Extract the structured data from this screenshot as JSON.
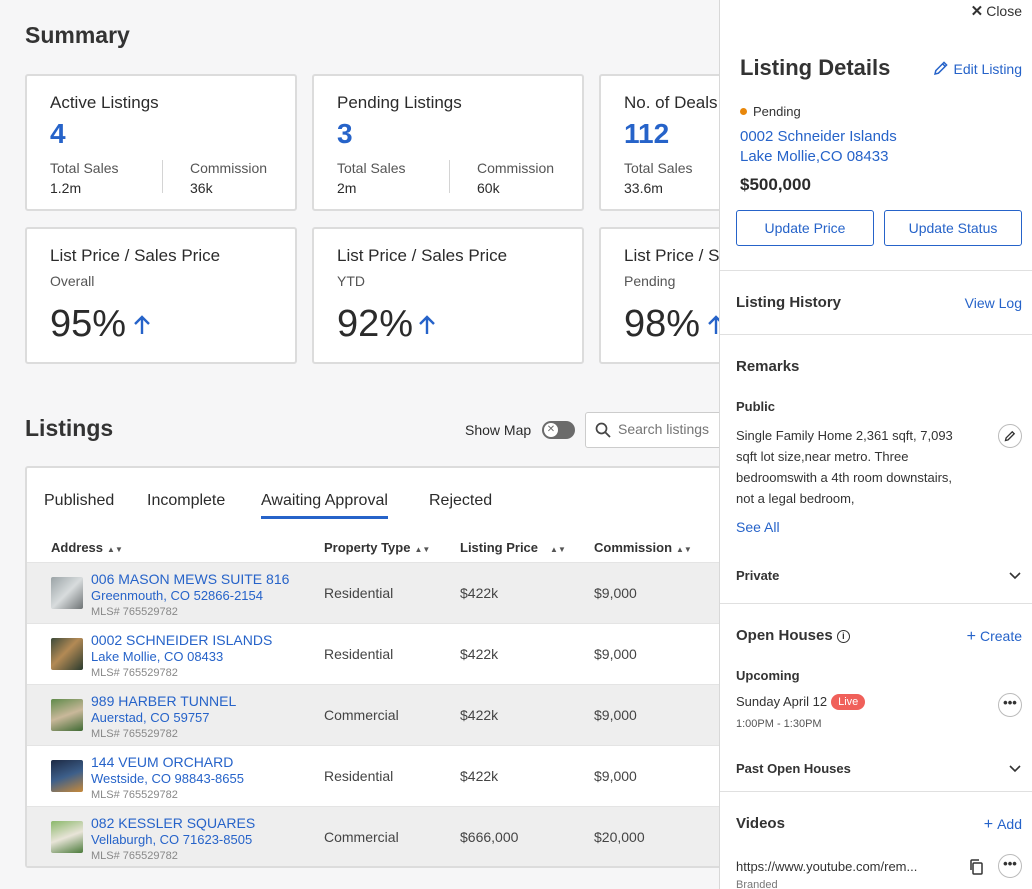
{
  "summary": {
    "title": "Summary",
    "cards": [
      {
        "title": "Active Listings",
        "count": "4",
        "sales_label": "Total Sales",
        "sales_value": "1.2m",
        "commission_label": "Commission",
        "commission_value": "36k"
      },
      {
        "title": "Pending Listings",
        "count": "3",
        "sales_label": "Total Sales",
        "sales_value": "2m",
        "commission_label": "Commission",
        "commission_value": "60k"
      },
      {
        "title": "No. of Deals",
        "count": "112",
        "sales_label": "Total Sales",
        "sales_value": "33.6m"
      }
    ],
    "ratio_cards": [
      {
        "title": "List Price / Sales Price",
        "subtitle": "Overall",
        "value": "95%"
      },
      {
        "title": "List Price / Sales Price",
        "subtitle": "YTD",
        "value": "92%"
      },
      {
        "title": "List Price / Sales Price",
        "subtitle": "Pending",
        "value": "98%"
      }
    ]
  },
  "listings": {
    "title": "Listings",
    "show_map_label": "Show Map",
    "search_placeholder": "Search listings",
    "tabs": [
      "Published",
      "Incomplete",
      "Awaiting Approval",
      "Rejected"
    ],
    "active_tab": "Awaiting Approval",
    "columns": [
      "Address",
      "Property Type",
      "Listing Price",
      "Commission"
    ],
    "rows": [
      {
        "address1": "006 MASON MEWS SUITE 816",
        "address2": "Greenmouth, CO 52866-2154",
        "mls": "MLS# 765529782",
        "type": "Residential",
        "price": "$422k",
        "commission": "$9,000"
      },
      {
        "address1": "0002 SCHNEIDER ISLANDS",
        "address2": "Lake Mollie, CO 08433",
        "mls": "MLS# 765529782",
        "type": "Residential",
        "price": "$422k",
        "commission": "$9,000"
      },
      {
        "address1": "989 HARBER TUNNEL",
        "address2": "Auerstad, CO 59757",
        "mls": "MLS# 765529782",
        "type": "Commercial",
        "price": "$422k",
        "commission": "$9,000"
      },
      {
        "address1": "144 VEUM ORCHARD",
        "address2": "Westside, CO 98843-8655",
        "mls": "MLS# 765529782",
        "type": "Residential",
        "price": "$422k",
        "commission": "$9,000"
      },
      {
        "address1": "082 KESSLER SQUARES",
        "address2": "Vellaburgh, CO 71623-8505",
        "mls": "MLS# 765529782",
        "type": "Commercial",
        "price": "$666,000",
        "commission": "$20,000"
      }
    ]
  },
  "panel": {
    "close_label": "Close",
    "title": "Listing Details",
    "edit_label": "Edit Listing",
    "status": "Pending",
    "address_line1": "0002 Schneider Islands",
    "address_line2": "Lake Mollie,CO 08433",
    "price": "$500,000",
    "update_price_label": "Update Price",
    "update_status_label": "Update Status",
    "history_title": "Listing History",
    "view_log_label": "View Log",
    "remarks_title": "Remarks",
    "public_label": "Public",
    "public_text": "Single Family Home 2,361 sqft, 7,093 sqft lot size,near metro. Three bedroomswith a 4th room downstairs, not a legal bedroom,",
    "see_all_label": "See All",
    "private_label": "Private",
    "open_houses_title": "Open Houses",
    "create_label": "Create",
    "upcoming_label": "Upcoming",
    "upcoming_date": "Sunday April 12",
    "live_label": "Live",
    "upcoming_time": "1:00PM - 1:30PM",
    "past_label": "Past Open Houses",
    "videos_title": "Videos",
    "add_label": "Add",
    "video_url": "https://www.youtube.com/rem...",
    "video_type": "Branded"
  },
  "colors": {
    "accent": "#2663c9",
    "pending": "#e8870b",
    "live": "#f0605a"
  }
}
